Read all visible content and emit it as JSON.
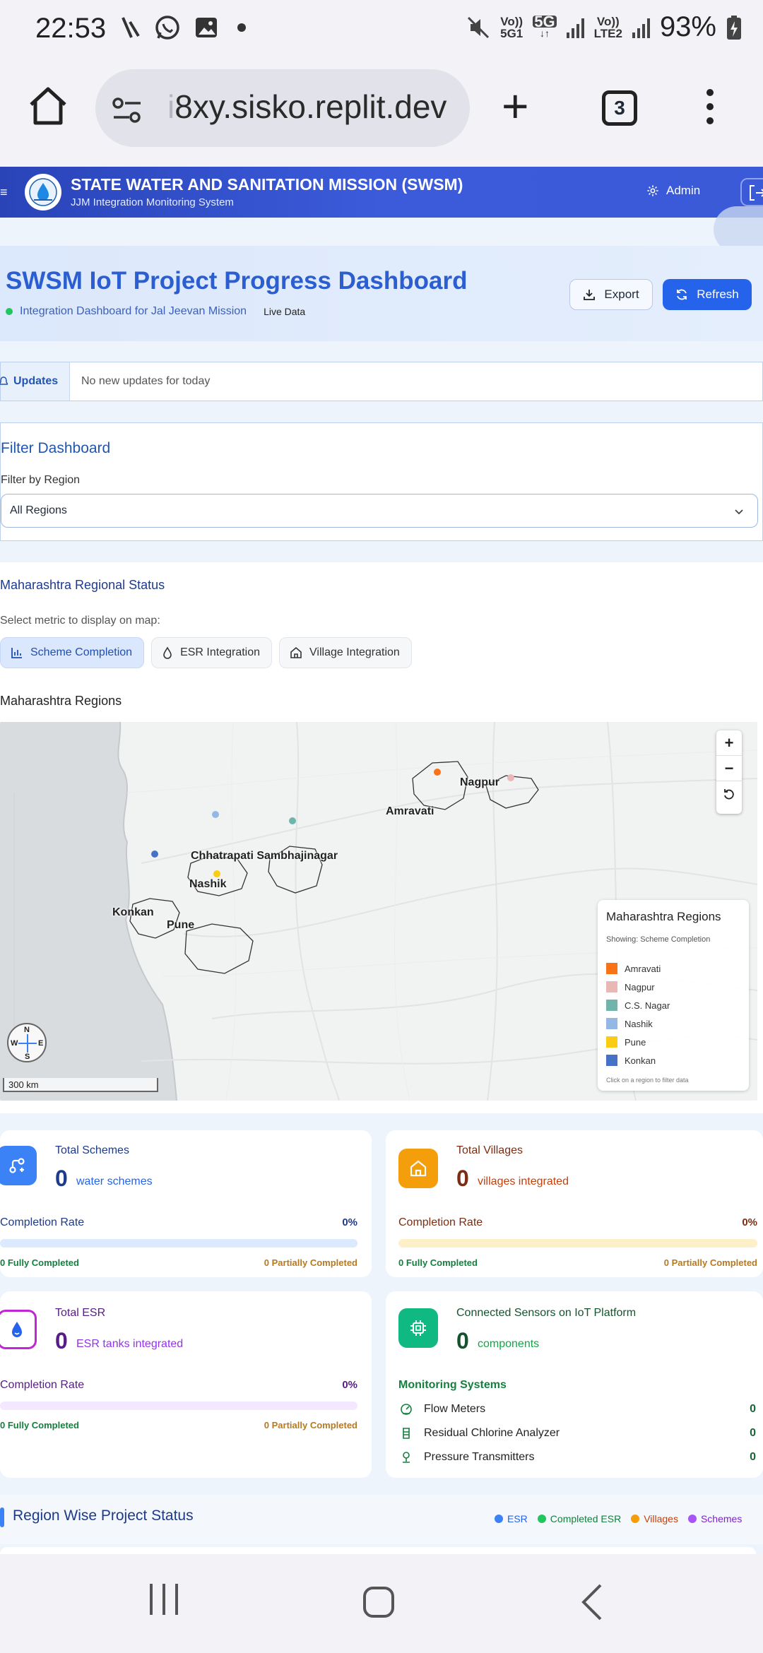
{
  "status_bar": {
    "time": "22:53",
    "network1_top": "Vo))",
    "network1_bottom": "5G1",
    "network_5g": "5G",
    "network2_top": "Vo))",
    "network2_bottom": "LTE2",
    "battery": "93%"
  },
  "browser": {
    "url_faded": "i",
    "url": "8xy.sisko.replit.dev",
    "tab_count": "3"
  },
  "header": {
    "title": "STATE WATER AND SANITATION MISSION (SWSM)",
    "subtitle": "JJM Integration Monitoring System",
    "admin_label": "Admin"
  },
  "hero": {
    "title": "SWSM IoT Project Progress Dashboard",
    "subtitle": "Integration Dashboard for Jal Jeevan Mission",
    "live": "Live Data",
    "export_label": "Export",
    "refresh_label": "Refresh"
  },
  "updates": {
    "tab_label": "Updates",
    "message": "No new updates for today"
  },
  "filter": {
    "title": "Filter Dashboard",
    "label": "Filter by Region",
    "selected": "All Regions"
  },
  "regional": {
    "title": "Maharashtra Regional Status",
    "metric_prompt": "Select metric to display on map:",
    "metrics": [
      "Scheme Completion",
      "ESR Integration",
      "Village Integration"
    ],
    "map_title": "Maharashtra Regions",
    "map_labels": {
      "nagpur": "Nagpur",
      "amravati": "Amravati",
      "cs_nagar": "Chhatrapati Sambhajinagar",
      "nashik": "Nashik",
      "konkan": "Konkan",
      "pune": "Pune"
    },
    "zoom_in": "+",
    "zoom_out": "−",
    "compass": {
      "n": "N",
      "s": "S",
      "e": "E",
      "w": "W"
    },
    "scale": "300 km",
    "legend": {
      "title": "Maharashtra Regions",
      "showing": "Showing: Scheme Completion",
      "items": [
        {
          "label": "Amravati",
          "color": "#f97316"
        },
        {
          "label": "Nagpur",
          "color": "#e9b7b4"
        },
        {
          "label": "C.S. Nagar",
          "color": "#6fb5ac"
        },
        {
          "label": "Nashik",
          "color": "#93b8e6"
        },
        {
          "label": "Pune",
          "color": "#facc15"
        },
        {
          "label": "Konkan",
          "color": "#4472c4"
        }
      ],
      "note": "Click on a region to filter data"
    }
  },
  "cards": {
    "schemes": {
      "title": "Total Schemes",
      "value": "0",
      "unit": "water schemes",
      "completion_label": "Completion Rate",
      "completion_pct": "0%",
      "fully": "0 Fully Completed",
      "partial": "0 Partially Completed"
    },
    "villages": {
      "title": "Total Villages",
      "value": "0",
      "unit": "villages integrated",
      "completion_label": "Completion Rate",
      "completion_pct": "0%",
      "fully": "0 Fully Completed",
      "partial": "0 Partially Completed"
    },
    "esr": {
      "title": "Total ESR",
      "value": "0",
      "unit": "ESR tanks integrated",
      "completion_label": "Completion Rate",
      "completion_pct": "0%",
      "fully": "0 Fully Completed",
      "partial": "0 Partially Completed"
    },
    "sensors": {
      "title": "Connected Sensors on IoT Platform",
      "value": "0",
      "unit": "components",
      "monitoring_title": "Monitoring Systems",
      "items": [
        {
          "label": "Flow Meters",
          "value": "0"
        },
        {
          "label": "Residual Chlorine Analyzer",
          "value": "0"
        },
        {
          "label": "Pressure Transmitters",
          "value": "0"
        }
      ]
    }
  },
  "region_wise": {
    "title": "Region Wise Project Status",
    "legend": [
      {
        "label": "ESR",
        "color": "#3b82f6"
      },
      {
        "label": "Completed ESR",
        "color": "#22c55e"
      },
      {
        "label": "Villages",
        "color": "#f59e0b"
      },
      {
        "label": "Schemes",
        "color": "#a855f7"
      }
    ]
  },
  "colors": {
    "header": "#3b5bdb",
    "primary": "#2563eb",
    "success": "#15803d",
    "warning": "#b7791f"
  }
}
